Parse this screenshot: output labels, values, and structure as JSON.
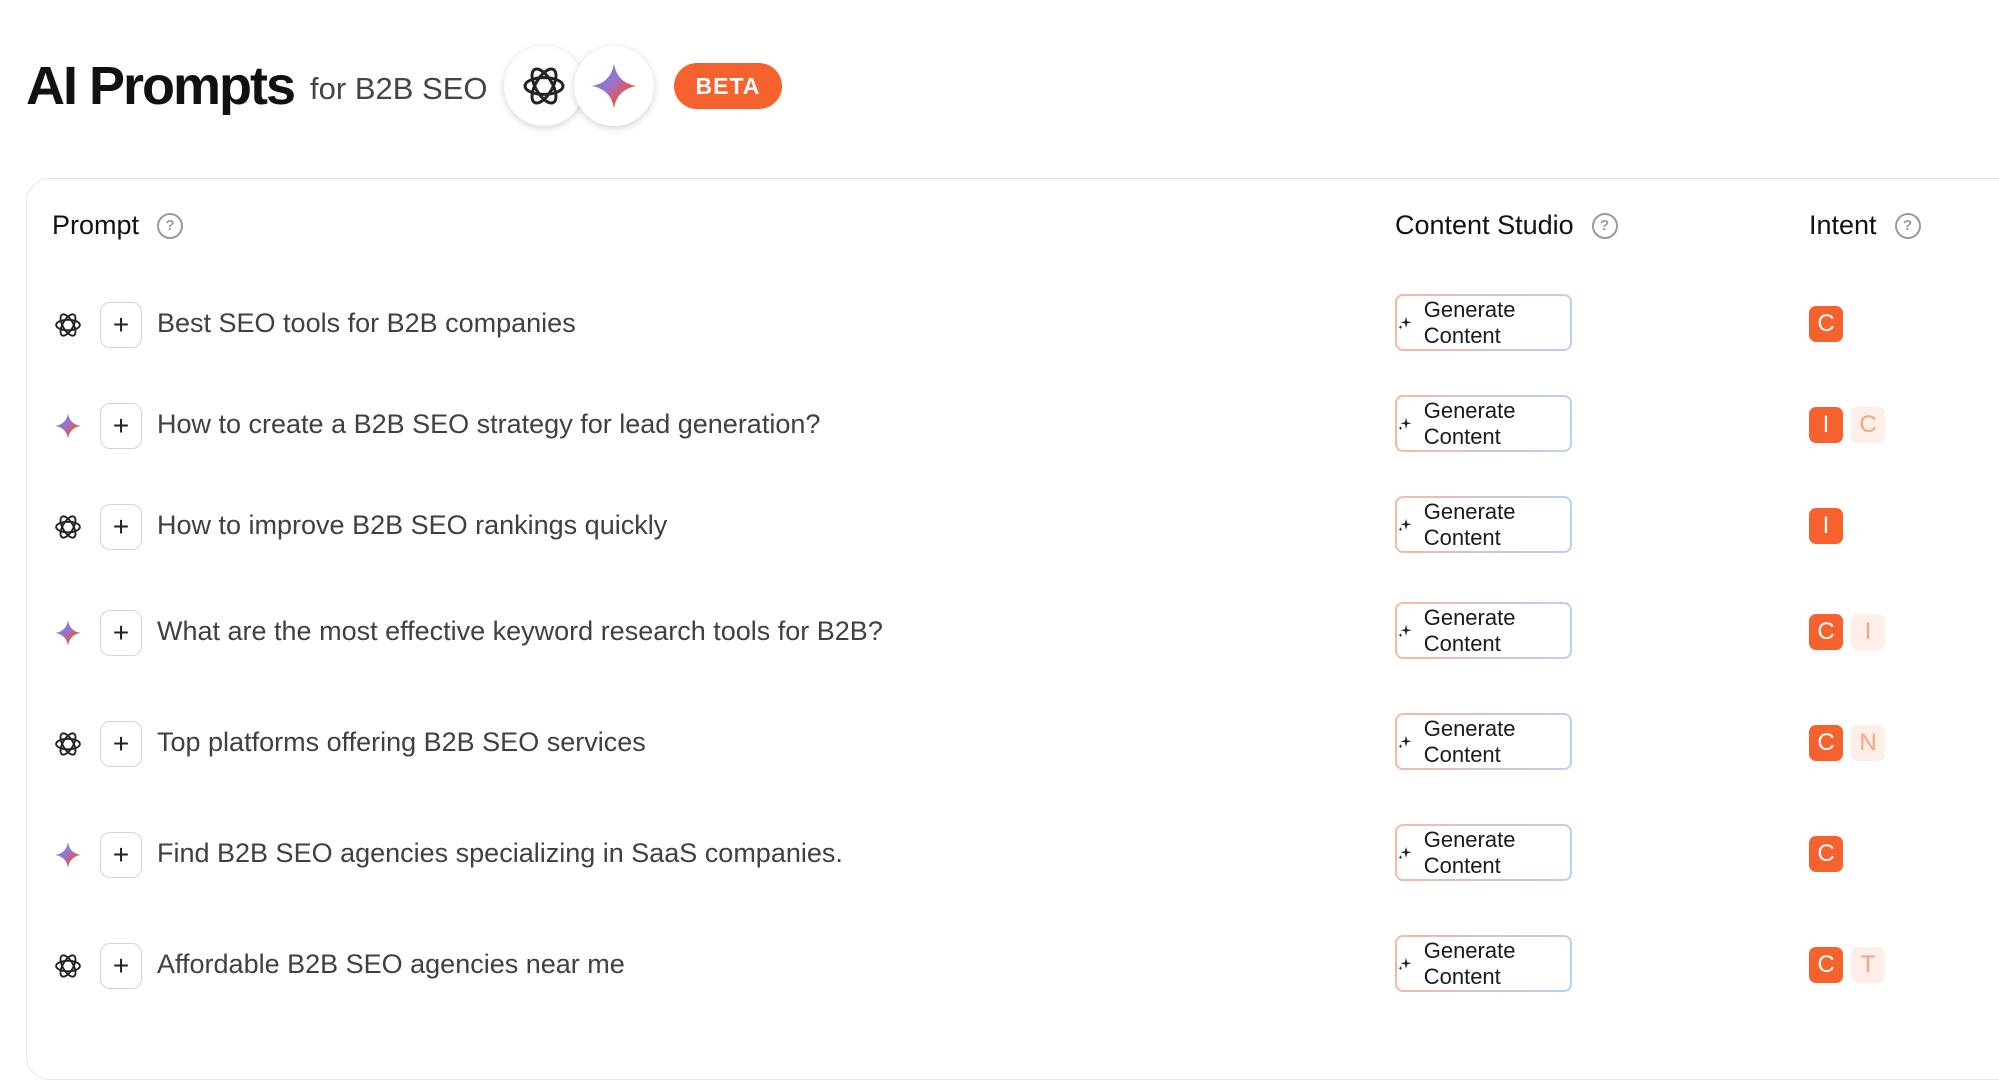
{
  "header": {
    "title": "AI Prompts",
    "subtitle": "for B2B SEO",
    "logos": [
      "chatgpt-logo",
      "gemini-logo"
    ],
    "beta": "BETA"
  },
  "columns": {
    "prompt": "Prompt",
    "content_studio": "Content Studio",
    "intent": "Intent"
  },
  "colors": {
    "accent": "#f5622d",
    "accent_light": "#fdeee7"
  },
  "rows": [
    {
      "model": "chatgpt",
      "prompt": "Best SEO tools for B2B companies",
      "button": "Generate Content",
      "intents": [
        "C"
      ]
    },
    {
      "model": "gemini",
      "prompt": "How to create a B2B SEO strategy for lead generation?",
      "button": "Generate Content",
      "intents": [
        "I",
        "C"
      ]
    },
    {
      "model": "chatgpt",
      "prompt": "How to improve B2B SEO rankings quickly",
      "button": "Generate Content",
      "intents": [
        "I"
      ]
    },
    {
      "model": "gemini",
      "prompt": "What are the most effective keyword research tools for B2B?",
      "button": "Generate Content",
      "intents": [
        "C",
        "I"
      ]
    },
    {
      "model": "chatgpt",
      "prompt": "Top platforms offering B2B SEO services",
      "button": "Generate Content",
      "intents": [
        "C",
        "N"
      ]
    },
    {
      "model": "gemini",
      "prompt": "Find B2B SEO agencies specializing in SaaS companies.",
      "button": "Generate Content",
      "intents": [
        "C"
      ]
    },
    {
      "model": "chatgpt",
      "prompt": "Affordable B2B SEO agencies near me",
      "button": "Generate Content",
      "intents": [
        "C",
        "T"
      ]
    }
  ]
}
